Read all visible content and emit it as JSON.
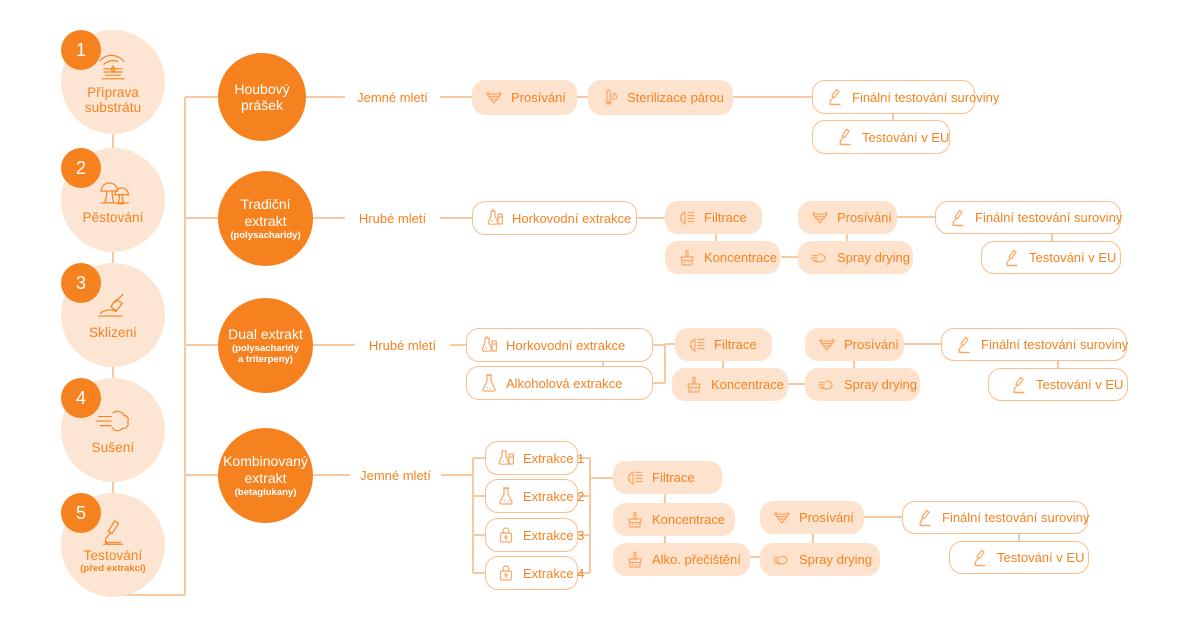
{
  "theme": {
    "orange": "#F5821F",
    "pale_circle": "#FCE6D3",
    "tint_box": "#FDE3CE",
    "line": "#F7C9A0",
    "outline": "#F8BE8E",
    "white": "#FFFFFF"
  },
  "steps": [
    {
      "num": "1",
      "label": "Příprava\nsubstrátu",
      "label_line1": "Příprava",
      "label_line2": "substrátu",
      "sub": "",
      "icon": "hand-substrate-icon"
    },
    {
      "num": "2",
      "label": "Pěstování",
      "label_line1": "Pěstování",
      "label_line2": "",
      "sub": "",
      "icon": "mushrooms-icon"
    },
    {
      "num": "3",
      "label": "Sklizení",
      "label_line1": "Sklizení",
      "label_line2": "",
      "sub": "",
      "icon": "harvest-trowel-icon"
    },
    {
      "num": "4",
      "label": "Sušení",
      "label_line1": "Sušení",
      "label_line2": "",
      "sub": "",
      "icon": "drying-air-icon"
    },
    {
      "num": "5",
      "label": "Testování",
      "label_line1": "Testování",
      "label_line2": "",
      "sub": "(před extrakcí)",
      "icon": "microscope-icon"
    }
  ],
  "branches": [
    {
      "id": "houbovy-prasek",
      "title_line1": "Houbový",
      "title_line2": "prášek",
      "subtitle": "",
      "nodes": [
        {
          "id": "jemne-mleti-1",
          "label": "Jemné mletí",
          "style": "white",
          "icon": ""
        },
        {
          "id": "prosivani-1",
          "label": "Prosívání",
          "style": "tint",
          "icon": "sieve-icon"
        },
        {
          "id": "sterilizace-parou",
          "label": "Sterilizace párou",
          "style": "tint",
          "icon": "thermometer-drop-icon"
        },
        {
          "id": "finalni-testovani-1",
          "label": "Finální testování suroviny",
          "style": "outline",
          "icon": "microscope-icon"
        },
        {
          "id": "testovani-eu-1",
          "label": "Testování v EU",
          "style": "outline",
          "icon": "microscope-icon"
        }
      ]
    },
    {
      "id": "tradicni-extrakt",
      "title_line1": "Tradiční",
      "title_line2": "extrakt",
      "subtitle": "(polysacharidy)",
      "nodes": [
        {
          "id": "hrube-mleti-2",
          "label": "Hrubé mletí",
          "style": "white",
          "icon": ""
        },
        {
          "id": "horkovodni-extrakce-2",
          "label": "Horkovodní extrakce",
          "style": "outline",
          "icon": "hot-water-flask-icon"
        },
        {
          "id": "filtrace-2",
          "label": "Filtrace",
          "style": "tint",
          "icon": "filter-icon"
        },
        {
          "id": "koncentrace-2",
          "label": "Koncentrace",
          "style": "tint",
          "icon": "concentrate-icon"
        },
        {
          "id": "prosivani-2",
          "label": "Prosívání",
          "style": "tint",
          "icon": "sieve-icon"
        },
        {
          "id": "spray-drying-2",
          "label": "Spray drying",
          "style": "tint",
          "icon": "spray-dry-icon"
        },
        {
          "id": "finalni-testovani-2",
          "label": "Finální testování suroviny",
          "style": "outline",
          "icon": "microscope-icon"
        },
        {
          "id": "testovani-eu-2",
          "label": "Testování v EU",
          "style": "outline",
          "icon": "microscope-icon"
        }
      ]
    },
    {
      "id": "dual-extrakt",
      "title_line1": "Dual extrakt",
      "title_line2": "",
      "subtitle_line1": "(polysacharidy",
      "subtitle_line2": "a triterpeny)",
      "subtitle": "(polysacharidy a triterpeny)",
      "nodes": [
        {
          "id": "hrube-mleti-3",
          "label": "Hrubé mletí",
          "style": "white",
          "icon": ""
        },
        {
          "id": "horkovodni-extrakce-3",
          "label": "Horkovodní extrakce",
          "style": "outline",
          "icon": "hot-water-flask-icon"
        },
        {
          "id": "alkoholova-extrakce-3",
          "label": "Alkoholová extrakce",
          "style": "outline",
          "icon": "flask-icon"
        },
        {
          "id": "filtrace-3",
          "label": "Filtrace",
          "style": "tint",
          "icon": "filter-icon"
        },
        {
          "id": "koncentrace-3",
          "label": "Koncentrace",
          "style": "tint",
          "icon": "concentrate-icon"
        },
        {
          "id": "prosivani-3",
          "label": "Prosívání",
          "style": "tint",
          "icon": "sieve-icon"
        },
        {
          "id": "spray-drying-3",
          "label": "Spray drying",
          "style": "tint",
          "icon": "spray-dry-icon"
        },
        {
          "id": "finalni-testovani-3",
          "label": "Finální testování suroviny",
          "style": "outline",
          "icon": "microscope-icon"
        },
        {
          "id": "testovani-eu-3",
          "label": "Testování v EU",
          "style": "outline",
          "icon": "microscope-icon"
        }
      ]
    },
    {
      "id": "kombinovany-extrakt",
      "title_line1": "Kombinovaný",
      "title_line2": "extrakt",
      "subtitle": "(betaglukany)",
      "nodes": [
        {
          "id": "jemne-mleti-4",
          "label": "Jemné mletí",
          "style": "white",
          "icon": ""
        },
        {
          "id": "extrakce-1",
          "label": "Extrakce 1",
          "style": "outline",
          "icon": "hot-water-flask-icon"
        },
        {
          "id": "extrakce-2",
          "label": "Extrakce 2",
          "style": "outline",
          "icon": "flask-icon"
        },
        {
          "id": "extrakce-3",
          "label": "Extrakce 3",
          "style": "outline",
          "icon": "lock-icon"
        },
        {
          "id": "extrakce-4",
          "label": "Extrakce 4",
          "style": "outline",
          "icon": "lock-icon"
        },
        {
          "id": "filtrace-4",
          "label": "Filtrace",
          "style": "tint",
          "icon": "filter-icon"
        },
        {
          "id": "koncentrace-4",
          "label": "Koncentrace",
          "style": "tint",
          "icon": "concentrate-icon"
        },
        {
          "id": "alko-precisteni-4",
          "label": "Alko. přečištění",
          "style": "tint",
          "icon": "concentrate-icon"
        },
        {
          "id": "prosivani-4",
          "label": "Prosívání",
          "style": "tint",
          "icon": "sieve-icon"
        },
        {
          "id": "spray-drying-4",
          "label": "Spray drying",
          "style": "tint",
          "icon": "spray-dry-icon"
        },
        {
          "id": "finalni-testovani-4",
          "label": "Finální testování suroviny",
          "style": "outline",
          "icon": "microscope-icon"
        },
        {
          "id": "testovani-eu-4",
          "label": "Testování v EU",
          "style": "outline",
          "icon": "microscope-icon"
        }
      ]
    }
  ]
}
